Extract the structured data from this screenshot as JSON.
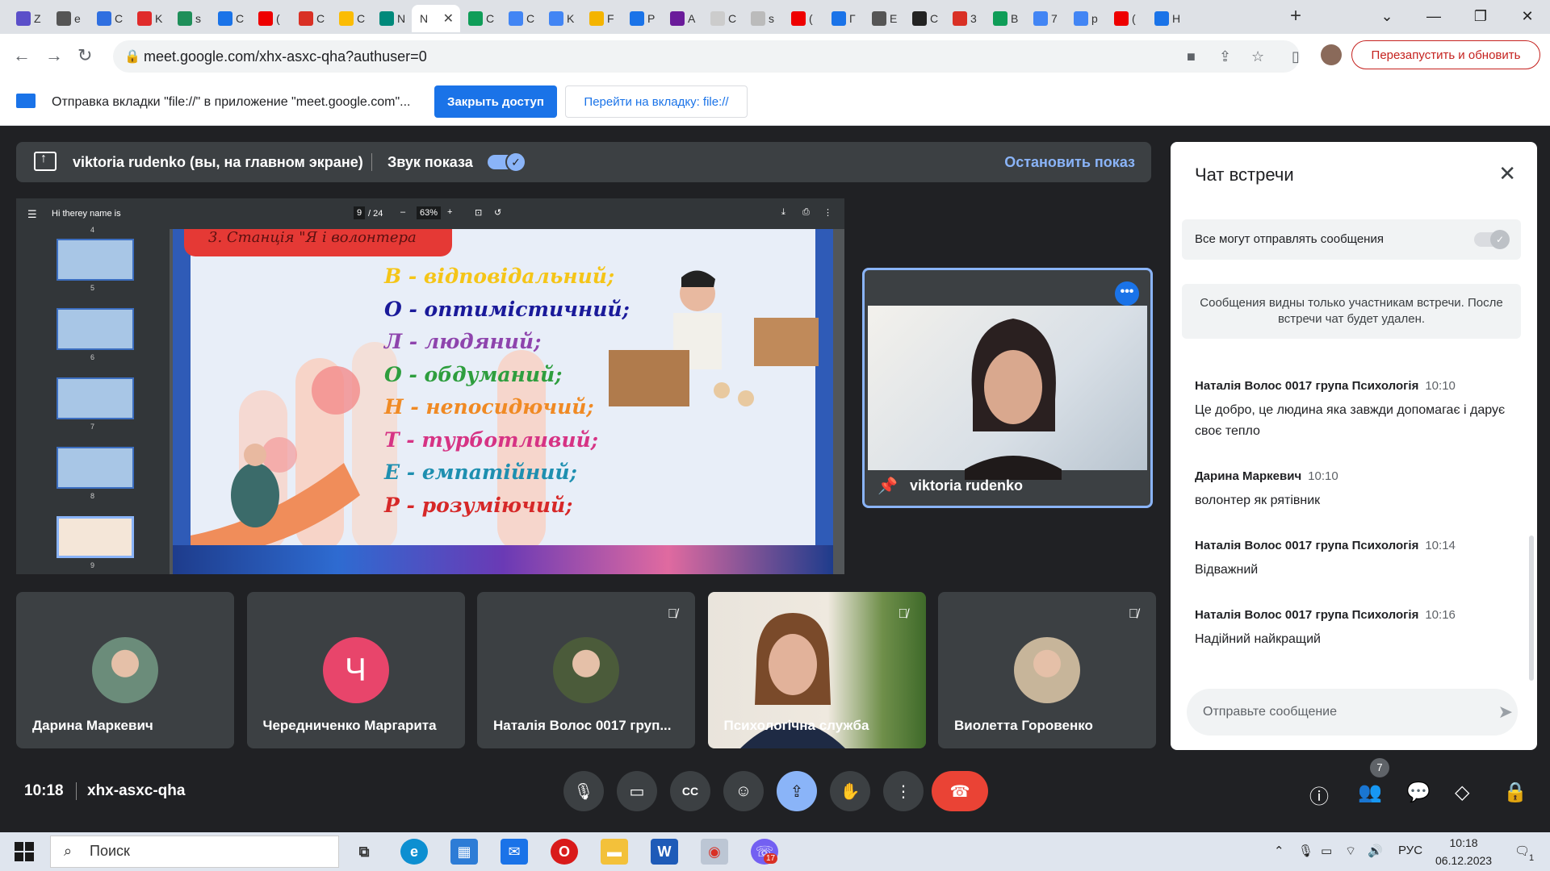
{
  "browser": {
    "tabs": [
      {
        "label": "Z",
        "color": "#5b4fc9"
      },
      {
        "label": "e",
        "color": "#555"
      },
      {
        "label": "C",
        "color": "#2f6fe0"
      },
      {
        "label": "K",
        "color": "#e02b2b"
      },
      {
        "label": "s",
        "color": "#1f8f5a"
      },
      {
        "label": "C",
        "color": "#1a73e8"
      },
      {
        "label": "(",
        "color": "#e00"
      },
      {
        "label": "C",
        "color": "#d93025"
      },
      {
        "label": "C",
        "color": "#fbbc04"
      },
      {
        "label": "N",
        "color": "#00897b"
      },
      {
        "label": "C",
        "color": "#0f9d58"
      },
      {
        "label": "C",
        "color": "#4285f4"
      },
      {
        "label": "K",
        "color": "#4285f4"
      },
      {
        "label": "F",
        "color": "#f4b400"
      },
      {
        "label": "P",
        "color": "#1a73e8"
      },
      {
        "label": "A",
        "color": "#6a1b9a"
      },
      {
        "label": "C",
        "color": "#ccc"
      },
      {
        "label": "s",
        "color": "#bbb"
      },
      {
        "label": "(",
        "color": "#e00"
      },
      {
        "label": "Г",
        "color": "#1a73e8"
      },
      {
        "label": "E",
        "color": "#555"
      },
      {
        "label": "C",
        "color": "#222"
      },
      {
        "label": "3",
        "color": "#d93025"
      },
      {
        "label": "B",
        "color": "#0f9d58"
      },
      {
        "label": "7",
        "color": "#4285f4"
      },
      {
        "label": "p",
        "color": "#4285f4"
      },
      {
        "label": "(",
        "color": "#e00"
      },
      {
        "label": "H",
        "color": "#1a73e8"
      }
    ],
    "active_tab_label": "N",
    "url": "meet.google.com/xhx-asxc-qha?authuser=0",
    "relaunch_label": "Перезапустить и обновить"
  },
  "infobar": {
    "text": "Отправка вкладки \"file://\" в приложение \"meet.google.com\"...",
    "close_access": "Закрыть доступ",
    "goto_tab": "Перейти на вкладку: file://"
  },
  "presenting": {
    "who": "viktoria rudenko (вы, на главном экране)",
    "sound_label": "Звук показа",
    "stop_label": "Остановить показ"
  },
  "pdf": {
    "doc_title": "Hi therey name is",
    "page": "9",
    "page_total": "/ 24",
    "zoom": "63%",
    "thumb_numbers": [
      "4",
      "5",
      "6",
      "7",
      "8",
      "9"
    ],
    "slide_header": "3. Станція \"Я і волонтера",
    "lines": [
      {
        "letter": "В",
        "text": "В - відповідальний;",
        "color": "#f5c518"
      },
      {
        "letter": "О",
        "text": "О - оптимістичний;",
        "color": "#1a1a9a"
      },
      {
        "letter": "Л",
        "text": "Л - людяний;",
        "color": "#8e44ad"
      },
      {
        "letter": "О",
        "text": "О - обдуманий;",
        "color": "#2e9e3e"
      },
      {
        "letter": "Н",
        "text": "Н - непосидючий;",
        "color": "#f08a24"
      },
      {
        "letter": "Т",
        "text": "Т - турботливий;",
        "color": "#d63384"
      },
      {
        "letter": "Е",
        "text": "Е - емпатійний;",
        "color": "#1e8fb0"
      },
      {
        "letter": "Р",
        "text": "Р - розуміючий;",
        "color": "#d62828"
      }
    ]
  },
  "pinned": {
    "name": "viktoria rudenko"
  },
  "participants": [
    {
      "name": "Дарина Маркевич",
      "avatar_color": "#6b8c7a",
      "muted": false,
      "initial": ""
    },
    {
      "name": "Чередниченко Маргарита",
      "avatar_color": "#e8456b",
      "muted": false,
      "initial": "Ч"
    },
    {
      "name": "Наталія Волос 0017 груп...",
      "avatar_color": "#4b5b3a",
      "muted": true,
      "initial": ""
    },
    {
      "name": "Психологічна служба",
      "avatar_color": "#8a8f70",
      "muted": true,
      "initial": ""
    },
    {
      "name": "Виолетта Горовенко",
      "avatar_color": "#c7b59a",
      "muted": true,
      "initial": ""
    }
  ],
  "chat": {
    "title": "Чат встречи",
    "permission": "Все могут отправлять сообщения",
    "note": "Сообщения видны только участникам встречи. После встречи чат будет удален.",
    "messages": [
      {
        "author": "Наталія Волос 0017 група Психологія",
        "time": "10:10",
        "text": "Це добро, це людина яка завжди допомагає і дарує своє тепло"
      },
      {
        "author": "Дарина Маркевич",
        "time": "10:10",
        "text": "волонтер як рятівник"
      },
      {
        "author": "Наталія Волос 0017 група Психологія",
        "time": "10:14",
        "text": "Відважний"
      },
      {
        "author": "Наталія Волос 0017 група Психологія",
        "time": "10:16",
        "text": "Надійний найкращий"
      }
    ],
    "placeholder": "Отправьте сообщение"
  },
  "controls": {
    "time": "10:18",
    "meeting_code": "xhx-asxc-qha",
    "participants_count": "7"
  },
  "taskbar": {
    "search": "Поиск",
    "lang": "РУС",
    "time": "10:18",
    "date": "06.12.2023",
    "viber_badge": "17",
    "notif": "1"
  }
}
